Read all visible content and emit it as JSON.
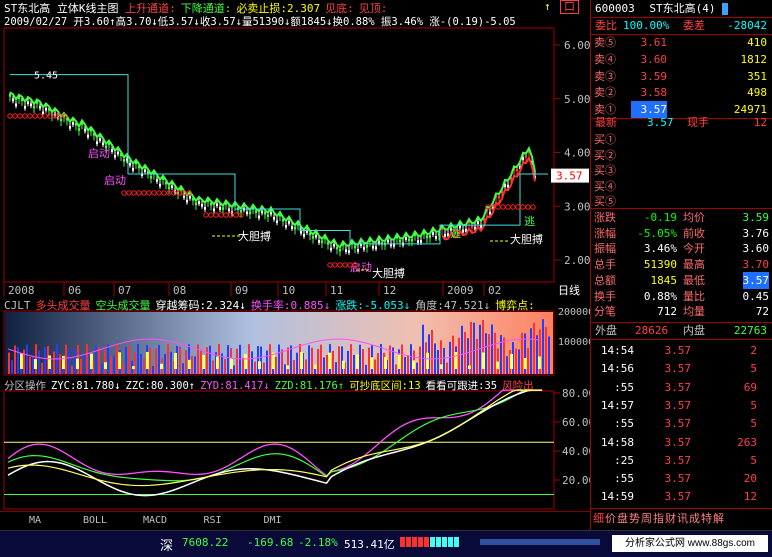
{
  "chart_header": {
    "name": "ST东北高",
    "title": "立体K线主图",
    "indicators": [
      {
        "text": "上升通道:",
        "color": "#ff4040"
      },
      {
        "text": "下降通道:",
        "color": "#40ff40"
      },
      {
        "text": "必卖止损:2.307",
        "color": "#ffff00"
      },
      {
        "text": "见底:",
        "color": "#ff4040"
      },
      {
        "text": "见顶:",
        "color": "#ff4040"
      }
    ],
    "ohlc": "2009/02/27 开3.60↑高3.70↓低3.57↓收3.57↓量51390↓额1845↓换0.88% 振3.46% 涨-(0.19)-5.05",
    "sell_button": "口",
    "up_arrow": "↑"
  },
  "main_chart": {
    "y_ticks": [
      "6.00",
      "5.00",
      "4.00",
      "3.00",
      "2.00"
    ],
    "x_labels": [
      "2008",
      "06",
      "07",
      "08",
      "09",
      "10",
      "11",
      "12",
      "2009",
      "02"
    ],
    "period": "日线",
    "max_label": "5.45",
    "price_tag": "3.57",
    "annotations": [
      "启动",
      "启动",
      "大胆搏",
      "大胆搏",
      "大胆搏",
      "逃",
      "逃",
      "启动"
    ]
  },
  "volume_panel": {
    "header": [
      {
        "text": "CJLT",
        "color": "#c0c0c0"
      },
      {
        "text": "多头成交量",
        "color": "#ff4040"
      },
      {
        "text": "空头成交量",
        "color": "#40ff40"
      },
      {
        "text": "穿越筹码:2.324↓",
        "color": "#ffffff"
      },
      {
        "text": "换手率:0.885↓",
        "color": "#ff50ff"
      },
      {
        "text": "涨跌:-5.053↓",
        "color": "#00ffff"
      },
      {
        "text": "角度:47.521↓",
        "color": "#c0c0c0"
      },
      {
        "text": "博弈点:",
        "color": "#ffff00"
      }
    ],
    "y_ticks": [
      "200000",
      "100000"
    ]
  },
  "osc_panel": {
    "header": [
      {
        "text": "分区操作",
        "color": "#c0c0c0"
      },
      {
        "text": "ZYC:81.780↓",
        "color": "#ffffff"
      },
      {
        "text": "ZZC:80.300↑",
        "color": "#ffffff"
      },
      {
        "text": "ZYD:81.417↓",
        "color": "#ff50ff"
      },
      {
        "text": "ZZD:81.176↑",
        "color": "#40ff40"
      },
      {
        "text": "可抄底区间:13",
        "color": "#ffff00"
      },
      {
        "text": "看看可跟进:35",
        "color": "#ffffff"
      },
      {
        "text": "风险出",
        "color": "#ff4040"
      }
    ],
    "y_ticks": [
      "80.00",
      "60.00",
      "40.00",
      "20.00"
    ]
  },
  "tabs": [
    "MA",
    "BOLL",
    "MACD",
    "RSI",
    "DMI"
  ],
  "quote": {
    "code": "600003",
    "name": "ST东北高(4)",
    "weibi": {
      "label": "委比",
      "value": "100.00%"
    },
    "weicha": {
      "label": "委差",
      "value": "-28042"
    },
    "sells": [
      {
        "label": "卖⑤",
        "price": "3.61",
        "vol": "410"
      },
      {
        "label": "卖④",
        "price": "3.60",
        "vol": "1812"
      },
      {
        "label": "卖③",
        "price": "3.59",
        "vol": "351"
      },
      {
        "label": "卖②",
        "price": "3.58",
        "vol": "498"
      },
      {
        "label": "卖①",
        "price": "3.57",
        "vol": "24971"
      }
    ],
    "latest": {
      "label": "最新",
      "value": "3.57",
      "label2": "现手",
      "value2": "12"
    },
    "buys": [
      "买①",
      "买②",
      "买③",
      "买④",
      "买⑤"
    ],
    "stats": [
      {
        "l1": "涨跌",
        "v1": "-0.19",
        "l2": "均价",
        "v2": "3.59"
      },
      {
        "l1": "涨幅",
        "v1": "-5.05%",
        "l2": "前收",
        "v2": "3.76"
      },
      {
        "l1": "振幅",
        "v1": "3.46%",
        "l2": "今开",
        "v2": "3.60"
      },
      {
        "l1": "总手",
        "v1": "51390",
        "l2": "最高",
        "v2": "3.70"
      },
      {
        "l1": "总额",
        "v1": "1845",
        "l2": "最低",
        "v2": "3.57"
      },
      {
        "l1": "换手",
        "v1": "0.88%",
        "l2": "量比",
        "v2": "0.45"
      },
      {
        "l1": "分笔",
        "v1": "712",
        "l2": "均量",
        "v2": "72"
      }
    ],
    "outer": {
      "label": "外盘",
      "value": "28626"
    },
    "inner": {
      "label": "内盘",
      "value": "22763"
    },
    "ticks": [
      {
        "time": "14:54",
        "price": "3.57",
        "vol": "2"
      },
      {
        "time": "14:56",
        "price": "3.57",
        "vol": "5"
      },
      {
        "time": ":55",
        "price": "3.57",
        "vol": "69"
      },
      {
        "time": "14:57",
        "price": "3.57",
        "vol": "5"
      },
      {
        "time": ":55",
        "price": "3.57",
        "vol": "5"
      },
      {
        "time": "14:58",
        "price": "3.57",
        "vol": "263"
      },
      {
        "time": ":25",
        "price": "3.57",
        "vol": "5"
      },
      {
        "time": ":55",
        "price": "3.57",
        "vol": "20"
      },
      {
        "time": "14:59",
        "price": "3.57",
        "vol": "12"
      }
    ],
    "bottom_tabs": [
      "细",
      "价",
      "盘",
      "势",
      "周",
      "指",
      "财",
      "讯",
      "成",
      "特",
      "解"
    ]
  },
  "status": {
    "market": "深",
    "index": "7608.22",
    "change": "-169.68",
    "pct": "-2.18%",
    "amount": "513.41亿",
    "watermark": "分析家公式网 www.88gs.com"
  }
}
